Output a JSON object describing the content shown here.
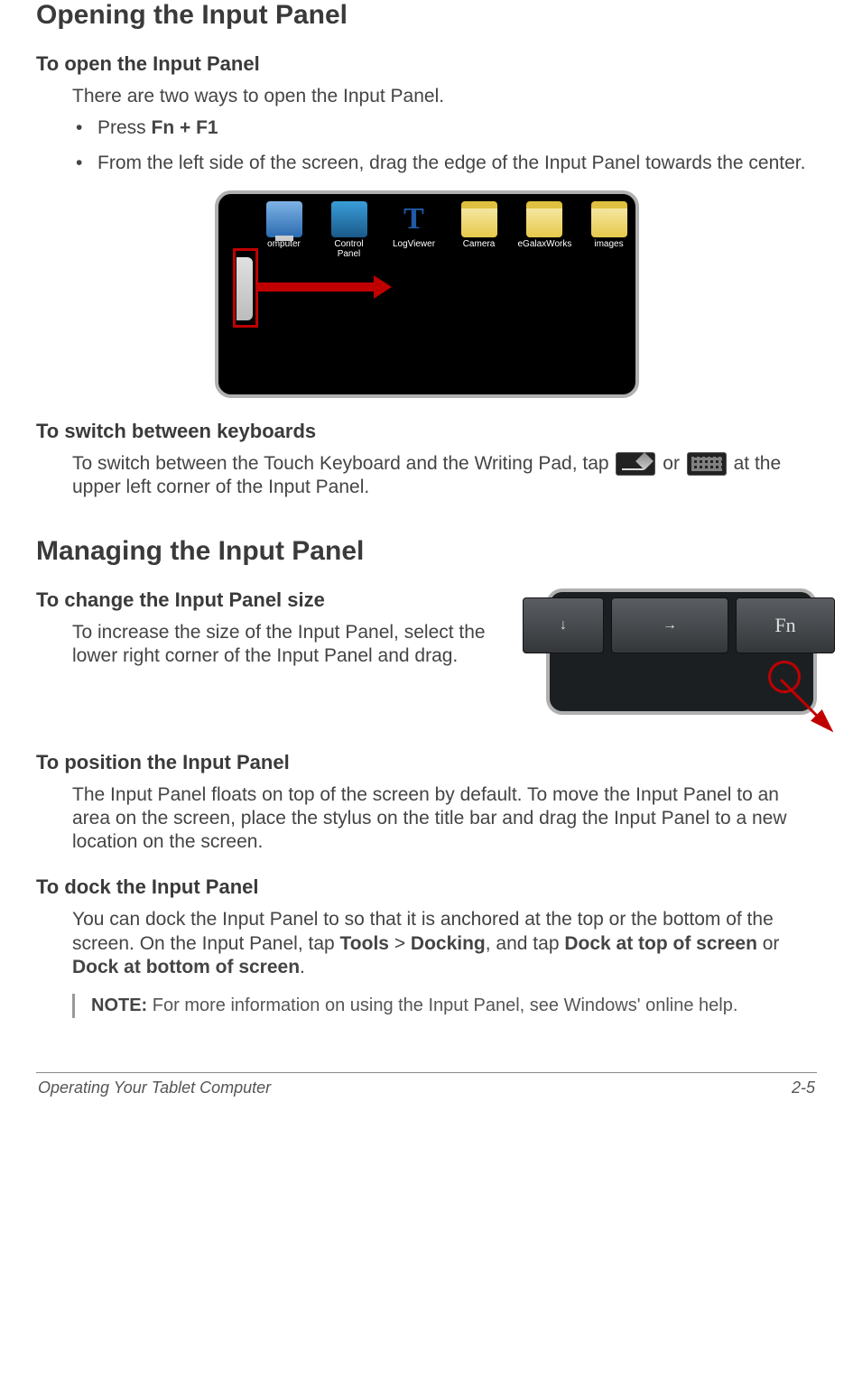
{
  "h_opening": "Opening the Input Panel",
  "s_open": {
    "heading": "To open the Input Panel",
    "intro": "There are two ways to open the Input Panel.",
    "bullets": [
      {
        "prefix": "Press ",
        "bold": "Fn + F1",
        "suffix": ""
      },
      {
        "prefix": "From the left side of the screen, drag the edge of the Input Panel towards the center.",
        "bold": "",
        "suffix": ""
      }
    ],
    "desktop_icons": [
      "omputer",
      "Control Panel",
      "LogViewer",
      "Camera",
      "eGalaxWorks",
      "images"
    ]
  },
  "s_switch": {
    "heading": "To switch between keyboards",
    "line_a": "To switch between the Touch Keyboard and the Writing Pad, tap ",
    "line_or": " or ",
    "line_b": " at the upper left corner of the Input Panel."
  },
  "h_managing": "Managing the Input Panel",
  "s_size": {
    "heading": "To change the Input Panel size",
    "text": "To increase the size of the Input Panel, select the lower right corner of the Input Panel and drag.",
    "keys": {
      "down": "↓",
      "right": "→",
      "fn": "Fn"
    }
  },
  "s_position": {
    "heading": "To position the Input Panel",
    "text": "The Input Panel floats on top of the screen by default. To move the Input Panel to an area on the screen, place the stylus on the title bar and drag the Input Panel to a new location on the screen."
  },
  "s_dock": {
    "heading": "To dock the Input Panel",
    "seg1": "You can dock the Input Panel to so that it is anchored at the top or the bottom of the screen. On the Input Panel, tap ",
    "b1": "Tools",
    "seg2": " > ",
    "b2": "Docking",
    "seg3": ", and tap ",
    "b3": "Dock at top of screen",
    "seg4": " or ",
    "b4": "Dock at bottom of screen",
    "seg5": "."
  },
  "note": {
    "label": "NOTE:",
    "text": " For more information on using the Input Panel, see Windows' online help."
  },
  "footer": {
    "left": "Operating Your Tablet Computer",
    "right": "2-5"
  }
}
